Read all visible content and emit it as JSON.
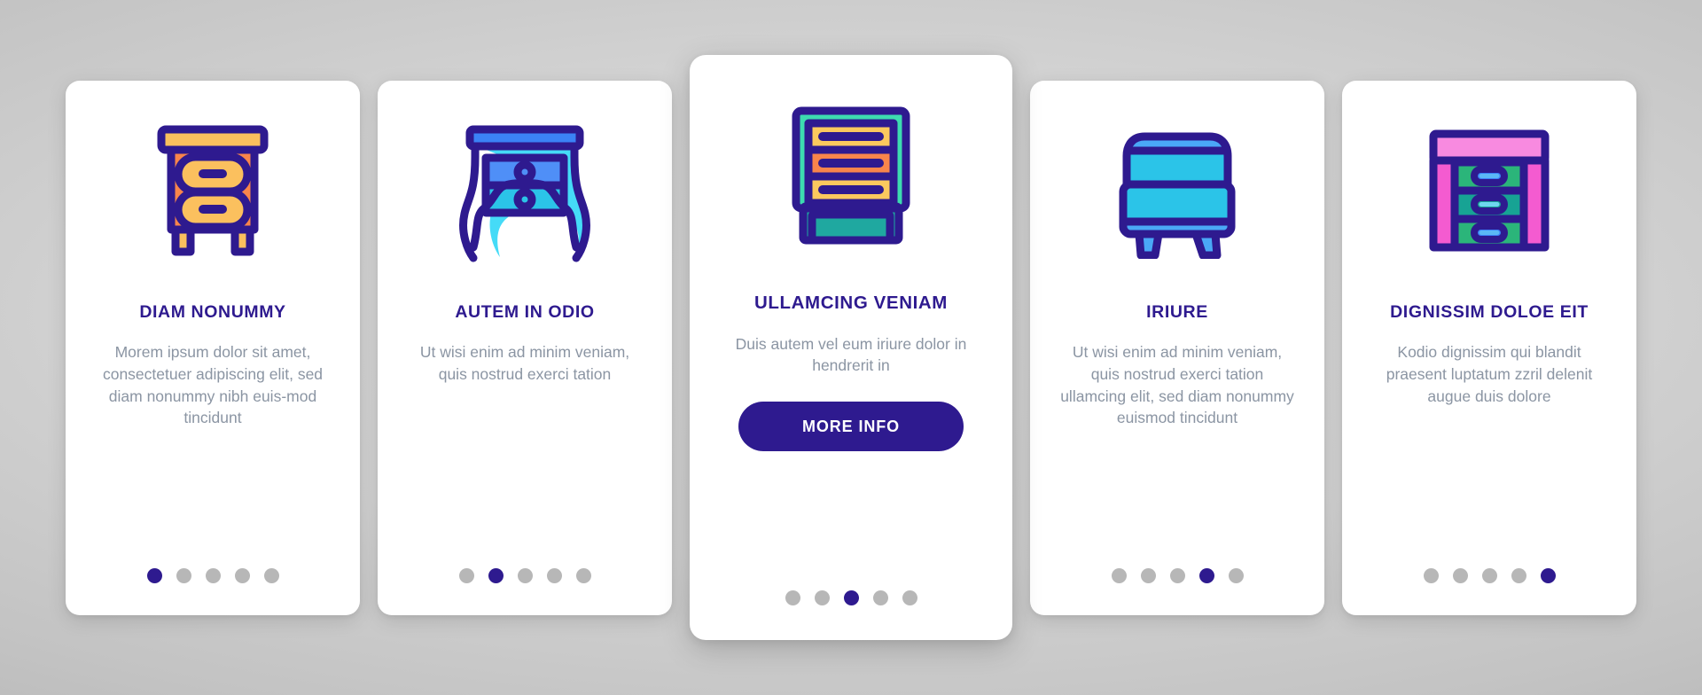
{
  "theme": {
    "accent": "#2e1a8f",
    "title_color": "#2e1a8f",
    "body_color": "#8b95a3",
    "dot_inactive": "#b7b7b7",
    "dot_active": "#2e1a8f",
    "card_bg": "#ffffff",
    "page_bg": "#cfcfcf",
    "icon_outline": "#2e1a8f"
  },
  "cards": [
    {
      "icon": "nightstand-two-drawer-orange-icon",
      "title": "DIAM NONUMMY",
      "body": "Morem ipsum dolor sit amet, consectetuer adipiscing elit, sed diam nonummy nibh euis-mod tincidunt",
      "featured": false,
      "button": null,
      "dots": {
        "count": 5,
        "active_index": 0
      }
    },
    {
      "icon": "nightstand-cabriole-legs-blue-icon",
      "title": "AUTEM IN ODIO",
      "body": "Ut wisi enim ad minim veniam, quis nostrud exerci tation",
      "featured": false,
      "button": null,
      "dots": {
        "count": 5,
        "active_index": 1
      }
    },
    {
      "icon": "cabinet-three-drawer-teal-icon",
      "title": "ULLAMCING VENIAM",
      "body": "Duis autem vel eum iriure dolor in hendrerit in",
      "featured": true,
      "button": "MORE INFO",
      "dots": {
        "count": 5,
        "active_index": 2
      }
    },
    {
      "icon": "nightstand-two-tier-cyan-icon",
      "title": "IRIURE",
      "body": "Ut wisi enim ad minim veniam, quis nostrud exerci tation ullamcing elit, sed diam nonummy euismod tincidunt",
      "featured": false,
      "button": null,
      "dots": {
        "count": 5,
        "active_index": 3
      }
    },
    {
      "icon": "dresser-three-drawer-pink-green-icon",
      "title": "DIGNISSIM DOLOE EIT",
      "body": "Kodio dignissim qui blandit praesent luptatum zzril delenit augue duis dolore",
      "featured": false,
      "button": null,
      "dots": {
        "count": 5,
        "active_index": 4
      }
    }
  ]
}
